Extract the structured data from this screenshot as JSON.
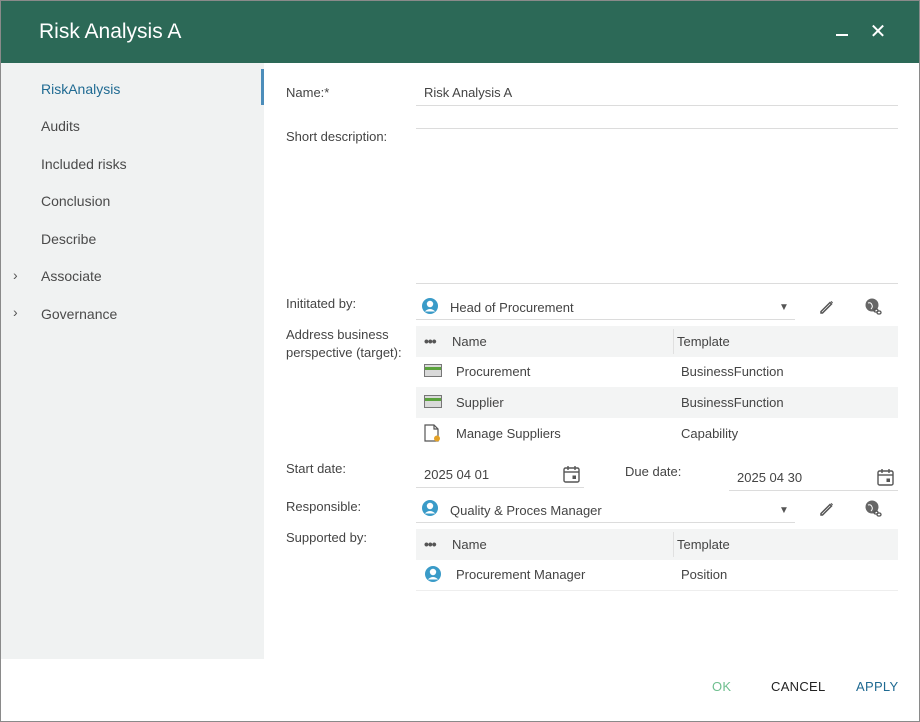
{
  "window": {
    "title": "Risk Analysis A"
  },
  "sidebar": {
    "items": [
      {
        "label": "RiskAnalysis",
        "expandable": false,
        "active": true
      },
      {
        "label": "Audits",
        "expandable": false
      },
      {
        "label": "Included risks",
        "expandable": false
      },
      {
        "label": "Conclusion",
        "expandable": false
      },
      {
        "label": "Describe",
        "expandable": false
      },
      {
        "label": "Associate",
        "expandable": true
      },
      {
        "label": "Governance",
        "expandable": true
      }
    ]
  },
  "form": {
    "name_label": "Name:*",
    "name_value": "Risk Analysis A",
    "short_description_label": "Short description:",
    "short_description_value": "",
    "initiated_by_label": "Inititated by:",
    "initiated_by_value": "Head of Procurement",
    "address_label": "Address business perspective (target):",
    "address_table": {
      "columns": [
        "Name",
        "Template"
      ],
      "rows": [
        {
          "icon": "business-function-icon",
          "name": "Procurement",
          "template": "BusinessFunction"
        },
        {
          "icon": "business-function-icon",
          "name": "Supplier",
          "template": "BusinessFunction"
        },
        {
          "icon": "capability-icon",
          "name": "Manage Suppliers",
          "template": "Capability"
        }
      ]
    },
    "start_date_label": "Start date:",
    "start_date_value": "2025 04 01",
    "due_date_label": "Due date:",
    "due_date_value": "2025 04 30",
    "responsible_label": "Responsible:",
    "responsible_value": "Quality & Proces Manager",
    "supported_by_label": "Supported by:",
    "supported_table": {
      "columns": [
        "Name",
        "Template"
      ],
      "rows": [
        {
          "icon": "position-icon",
          "name": "Procurement Manager",
          "template": "Position"
        }
      ]
    }
  },
  "footer": {
    "ok": "OK",
    "cancel": "CANCEL",
    "apply": "APPLY"
  },
  "colors": {
    "titlebar": "#2c6957",
    "accent": "#1f6a92",
    "ok_disabled": "#6fbf8f",
    "apply": "#1f6a92"
  }
}
